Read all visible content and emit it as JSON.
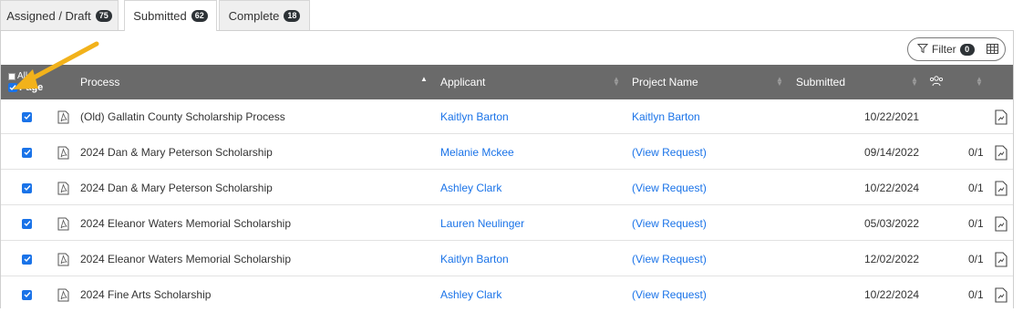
{
  "tabs": [
    {
      "label": "Assigned / Draft",
      "count": "75"
    },
    {
      "label": "Submitted",
      "count": "62"
    },
    {
      "label": "Complete",
      "count": "18"
    }
  ],
  "toolbar": {
    "filter_label": "Filter",
    "filter_count": "0"
  },
  "header": {
    "select_all": "All",
    "select_page": "Page",
    "process": "Process",
    "applicant": "Applicant",
    "project_name": "Project Name",
    "submitted": "Submitted"
  },
  "rows": [
    {
      "process": "(Old) Gallatin County Scholarship Process",
      "applicant": "Kaitlyn Barton",
      "project": "Kaitlyn Barton",
      "submitted": "10/22/2021",
      "reviewers": ""
    },
    {
      "process": "2024 Dan & Mary Peterson Scholarship",
      "applicant": "Melanie Mckee",
      "project": "(View Request)",
      "submitted": "09/14/2022",
      "reviewers": "0/1"
    },
    {
      "process": "2024 Dan & Mary Peterson Scholarship",
      "applicant": "Ashley Clark",
      "project": "(View Request)",
      "submitted": "10/22/2024",
      "reviewers": "0/1"
    },
    {
      "process": "2024 Eleanor Waters Memorial Scholarship",
      "applicant": "Lauren Neulinger",
      "project": "(View Request)",
      "submitted": "05/03/2022",
      "reviewers": "0/1"
    },
    {
      "process": "2024 Eleanor Waters Memorial Scholarship",
      "applicant": "Kaitlyn Barton",
      "project": "(View Request)",
      "submitted": "12/02/2022",
      "reviewers": "0/1"
    },
    {
      "process": "2024 Fine Arts Scholarship",
      "applicant": "Ashley Clark",
      "project": "(View Request)",
      "submitted": "10/22/2024",
      "reviewers": "0/1"
    }
  ],
  "colors": {
    "accent": "#1a73e8",
    "header_bg": "#6a6a6a",
    "arrow": "#f2b21b"
  }
}
